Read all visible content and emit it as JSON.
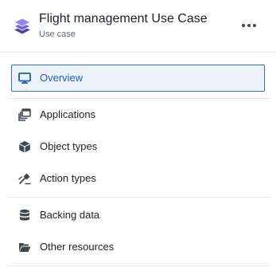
{
  "header": {
    "title": "Flight management Use Case",
    "subtitle": "Use case",
    "logo_icon": "layers-stack-icon",
    "more_icon": "more-horizontal-icon",
    "logo_color": "#7961db"
  },
  "nav": {
    "active_color": "#2d72d2",
    "items": [
      {
        "label": "Overview",
        "icon": "desktop-icon",
        "active": true
      },
      {
        "label": "Applications",
        "icon": "applications-icon",
        "active": false
      },
      {
        "label": "Object types",
        "icon": "cube-icon",
        "active": false
      },
      {
        "label": "Action types",
        "icon": "action-icon",
        "active": false
      },
      {
        "label": "Backing data",
        "icon": "database-icon",
        "active": false
      },
      {
        "label": "Other resources",
        "icon": "folder-open-icon",
        "active": false
      }
    ]
  }
}
